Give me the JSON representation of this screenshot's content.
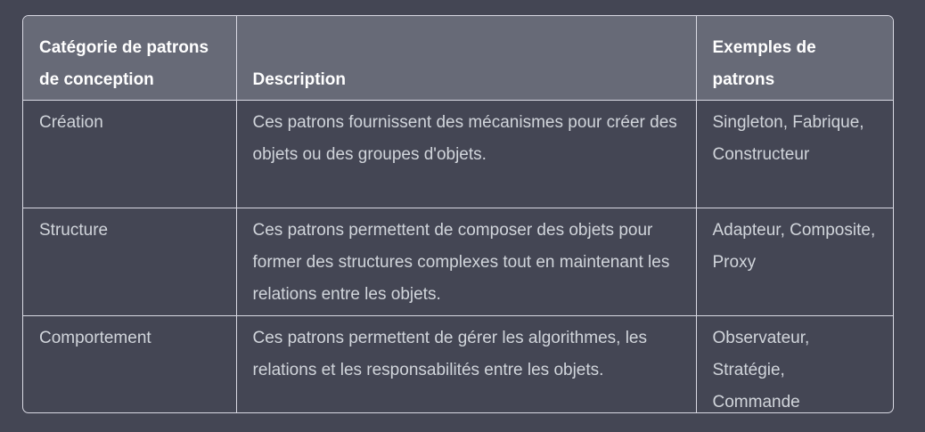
{
  "table": {
    "headers": [
      "Catégorie de patrons de conception",
      "Description",
      "Exemples de patrons"
    ],
    "rows": [
      {
        "category": "Création",
        "description": "Ces patrons fournissent des mécanismes pour créer des objets ou des groupes d'objets.",
        "examples": "Singleton, Fabrique, Constructeur"
      },
      {
        "category": "Structure",
        "description": "Ces patrons permettent de composer des objets pour former des structures complexes tout en maintenant les relations entre les objets.",
        "examples": "Adapteur, Composite, Proxy"
      },
      {
        "category": "Comportement",
        "description": "Ces patrons permettent de gérer les algorithmes, les relations et les responsabilités entre les objets.",
        "examples": "Observateur, Stratégie, Commande"
      }
    ]
  }
}
